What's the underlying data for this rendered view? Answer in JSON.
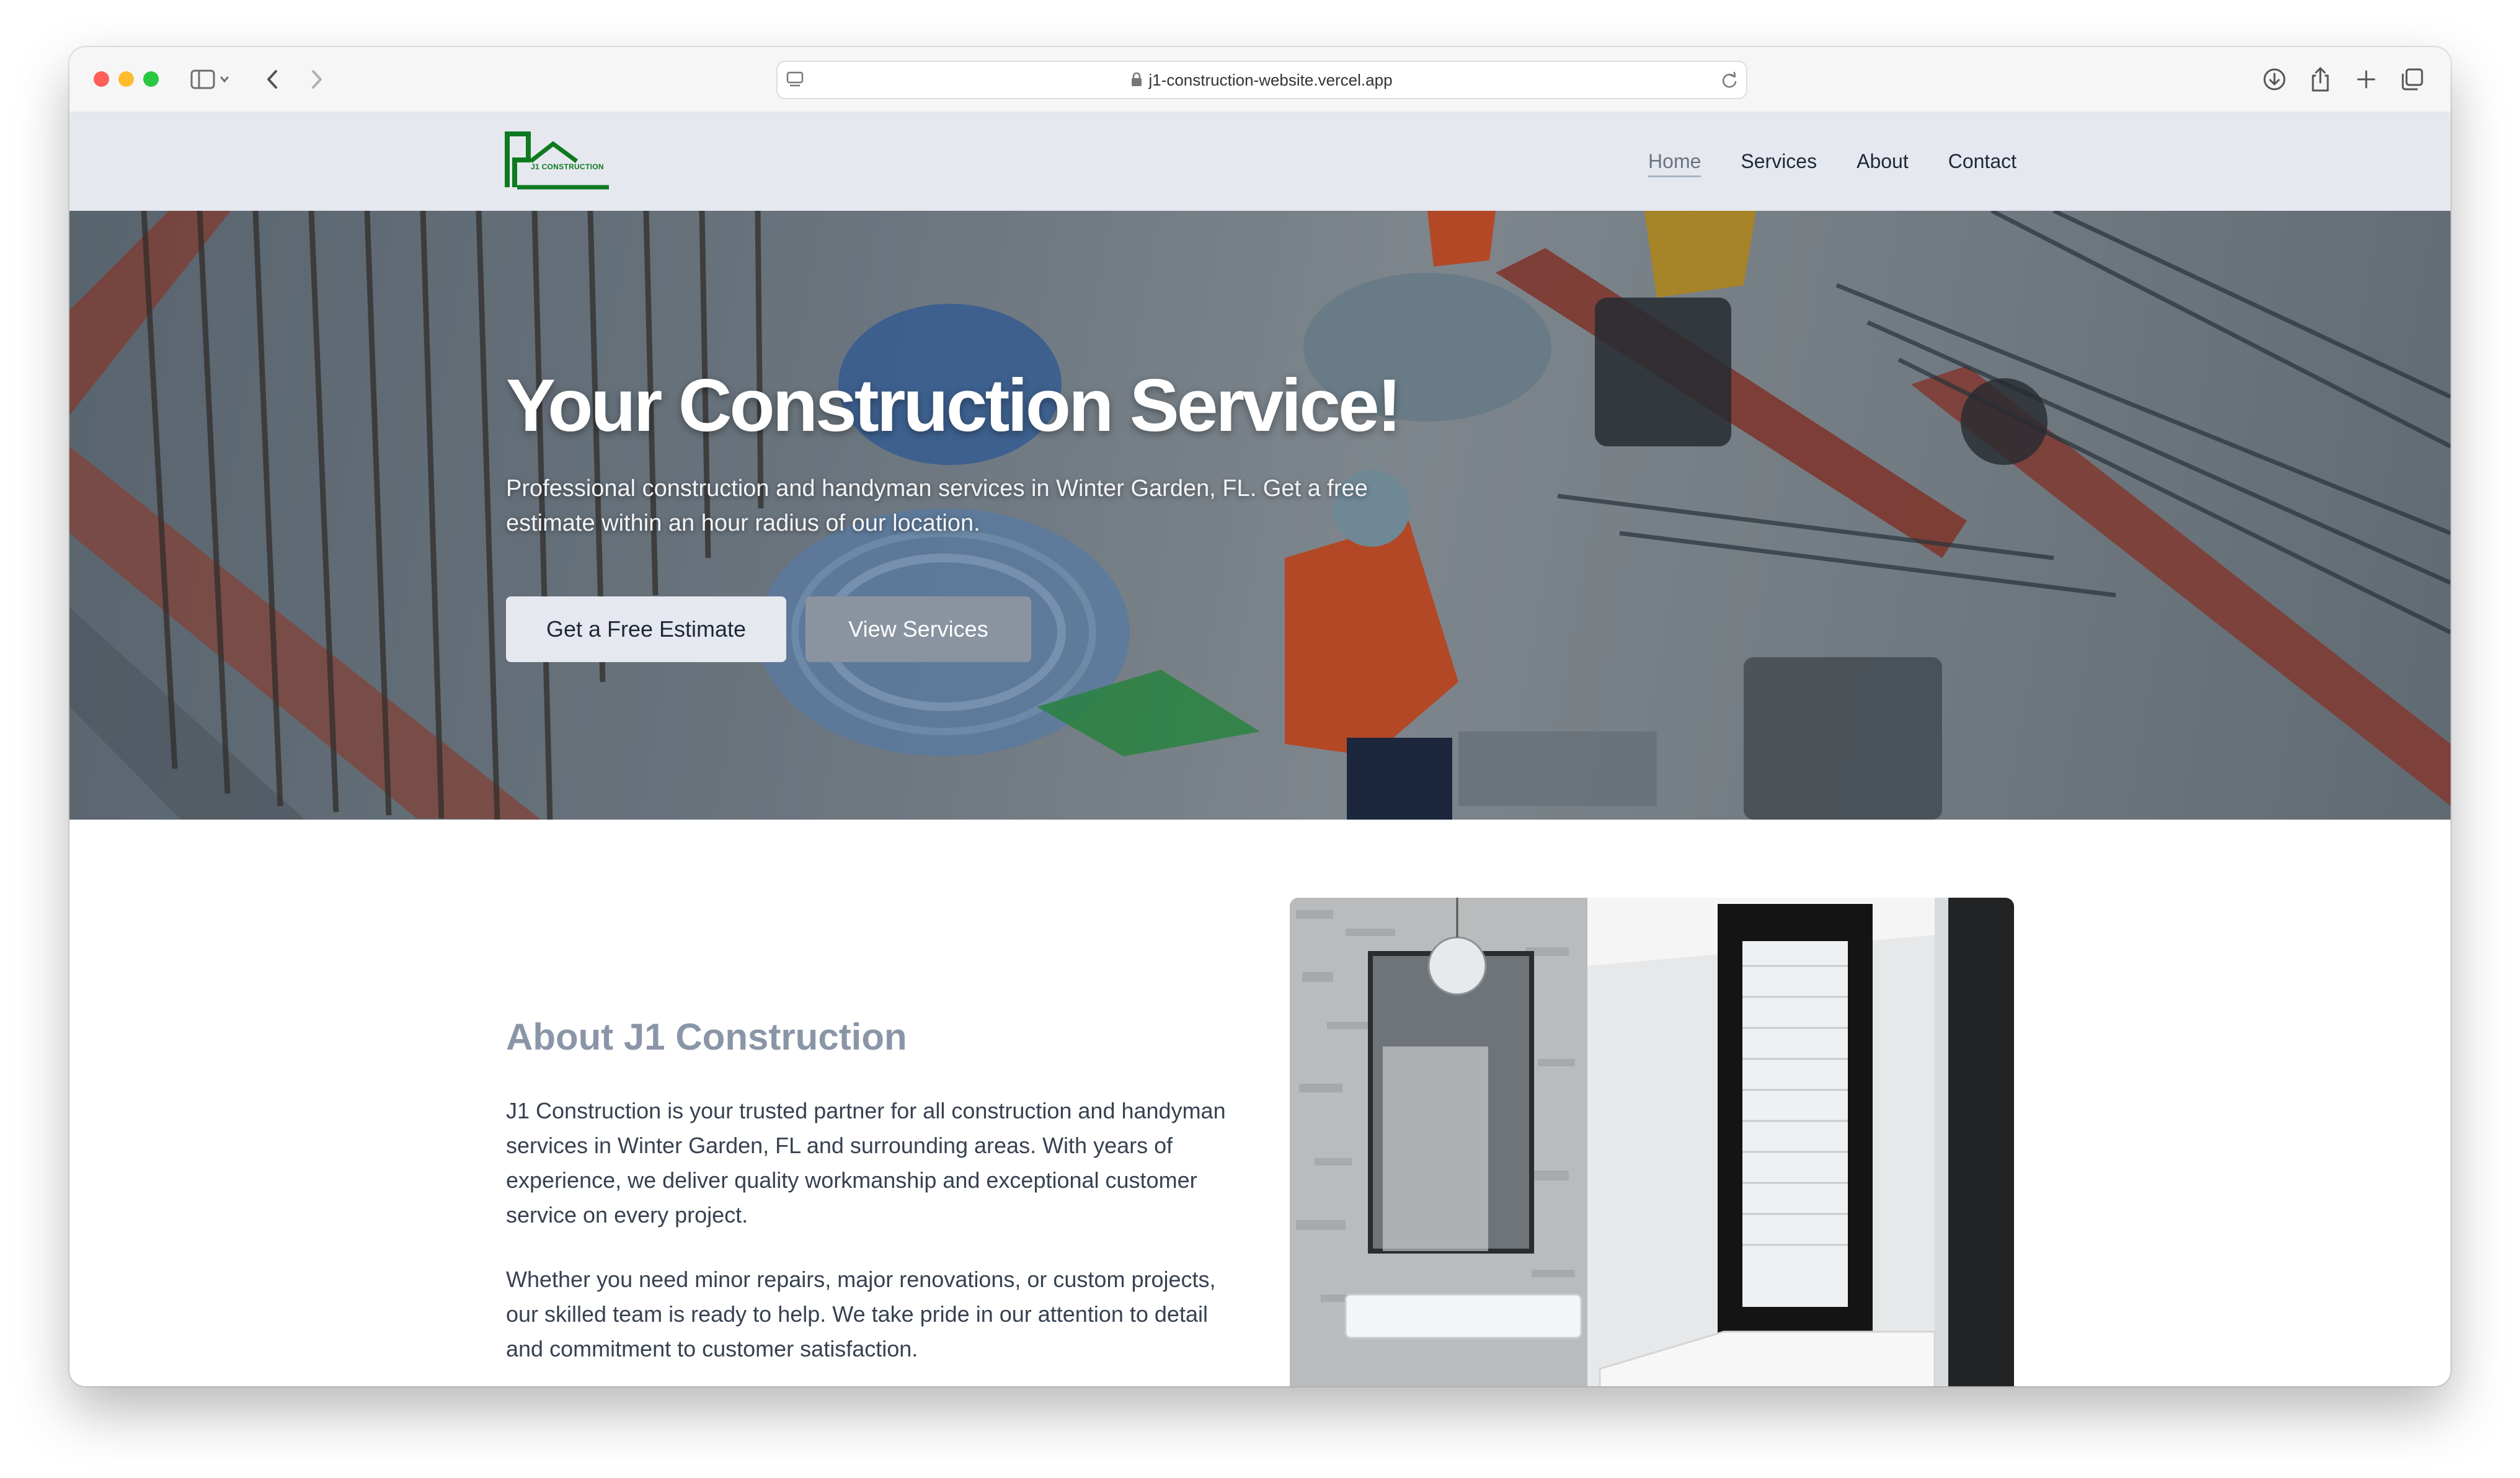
{
  "browser": {
    "url": "j1-construction-website.vercel.app"
  },
  "site": {
    "logo_text": "J1 CONSTRUCTION",
    "nav": [
      {
        "label": "Home",
        "active": true
      },
      {
        "label": "Services",
        "active": false
      },
      {
        "label": "About",
        "active": false
      },
      {
        "label": "Contact",
        "active": false
      }
    ]
  },
  "hero": {
    "title": "Your Construction Service!",
    "subtitle": "Professional construction and handyman services in Winter Garden, FL. Get a free estimate within an hour radius of our location.",
    "primary_button": "Get a Free Estimate",
    "secondary_button": "View Services"
  },
  "about": {
    "title": "About J1 Construction",
    "paragraphs": [
      "J1 Construction is your trusted partner for all construction and handyman services in Winter Garden, FL and surrounding areas. With years of experience, we deliver quality workmanship and exceptional customer service on every project.",
      "Whether you need minor repairs, major renovations, or custom projects, our skilled team is ready to help. We take pride in our attention to detail and commitment to customer satisfaction."
    ]
  },
  "colors": {
    "nav_bg": "#e6e8ef",
    "logo_green": "#0e7a1f",
    "about_title": "#8a96a8",
    "secondary_button": "#8a93a0"
  }
}
